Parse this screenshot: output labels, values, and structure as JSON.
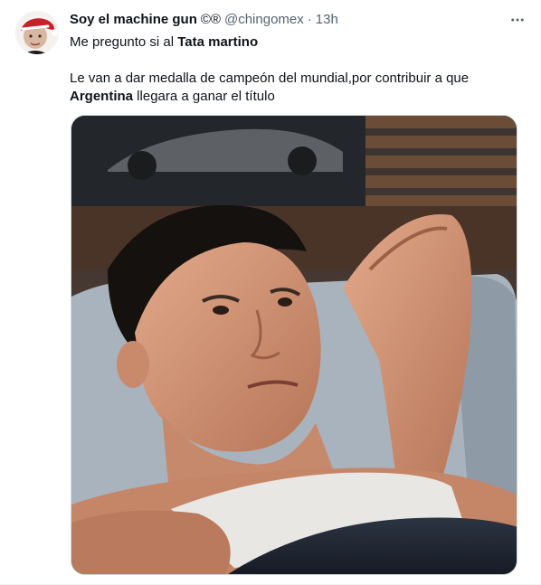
{
  "tweet": {
    "display_name": "Soy el machine gun",
    "badges": "©®",
    "handle": "@chingomex",
    "separator": "·",
    "timestamp": "13h",
    "more_icon": "more-horizontal-icon",
    "text": {
      "line1_prefix": "Me pregunto si al ",
      "line1_bold": "Tata martino",
      "line2_prefix": "Le van a dar medalla de campeón del mundial,por contribuir a que ",
      "line2_bold": "Argentina",
      "line2_suffix": " llegara a ganar el título"
    },
    "media": {
      "description_icon": "photo-man-lying-in-bed"
    }
  },
  "colors": {
    "text_primary": "#0f1419",
    "text_secondary": "#536471",
    "border": "#cfd9de"
  }
}
